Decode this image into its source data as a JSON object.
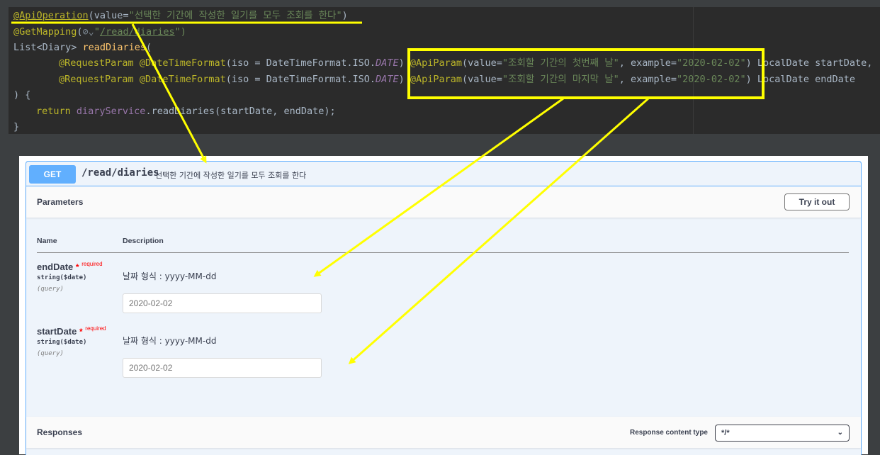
{
  "code": {
    "annotation_operation": "@ApiOperation",
    "op_value_prefix": "(value=",
    "op_value": "\"선택한 기간에 작성한 일기를 모두 조회를 한다\"",
    "op_close": ")",
    "get_mapping": "@GetMapping",
    "gm_open": "(",
    "gutter_icon": "⊘⌄",
    "path_open_quote": "\"",
    "path": "/read/diaries",
    "path_close": "\")",
    "return_type": "List<Diary> ",
    "method_name": "readDiaries",
    "method_open": "(",
    "request_param": "@RequestParam",
    "datetime_format": "@DateTimeFormat",
    "iso_prefix": "(iso = DateTimeFormat.ISO.",
    "iso_const": "DATE",
    "iso_close": ")",
    "api_param": "@ApiParam",
    "ap_value_prefix": "(value=",
    "start_desc": "\"조회할 기간의 첫번째 날\"",
    "end_desc": "\"조회할 기간의 마지막 날\"",
    "example_prefix": ", example=",
    "example_value": "\"2020-02-02\"",
    "ap_close": ")",
    "start_param": " LocalDate startDate,",
    "end_param": " LocalDate endDate",
    "close_brace_open": ") {",
    "return_kw": "return ",
    "service": "diaryService",
    "call": ".readDiaries(startDate, endDate);",
    "close_brace": "}"
  },
  "swagger": {
    "method": "GET",
    "path": "/read/diaries",
    "summary": "선택한 기간에 작성한 일기를 모두 조회를 한다",
    "parameters_title": "Parameters",
    "try_it_out": "Try it out",
    "col_name": "Name",
    "col_description": "Description",
    "params": [
      {
        "name": "endDate",
        "required_star": "*",
        "required": "required",
        "type": "string($date)",
        "in": "(query)",
        "description": "날짜 형식 : yyyy-MM-dd",
        "value": "2020-02-02"
      },
      {
        "name": "startDate",
        "required_star": "*",
        "required": "required",
        "type": "string($date)",
        "in": "(query)",
        "description": "날짜 형식 : yyyy-MM-dd",
        "value": "2020-02-02"
      }
    ],
    "responses_title": "Responses",
    "response_content_type_label": "Response content type",
    "response_content_type_value": "*/*"
  },
  "colors": {
    "highlight": "#ffff00",
    "get_method": "#61affe",
    "required": "#ff0000"
  }
}
